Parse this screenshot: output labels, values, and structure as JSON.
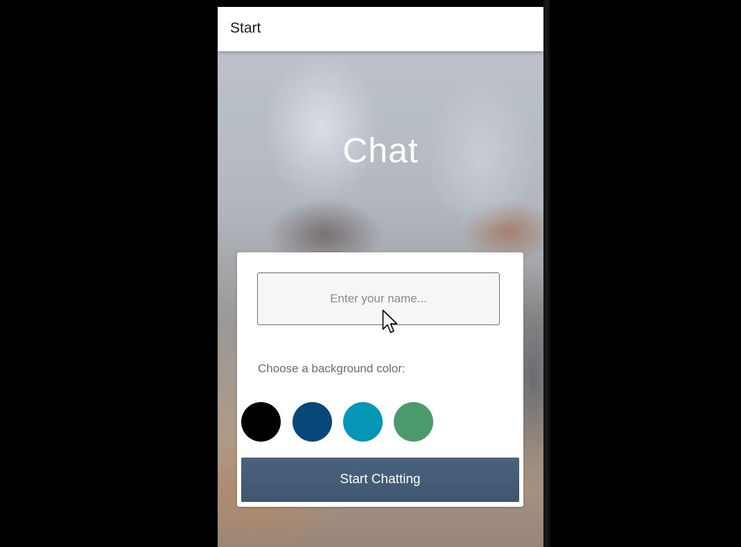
{
  "app_bar": {
    "title": "Start"
  },
  "main": {
    "title": "Chat"
  },
  "form": {
    "name_input": {
      "value": "",
      "placeholder": "Enter your name..."
    },
    "color_label": "Choose a background color:",
    "colors": [
      {
        "name": "black",
        "hex": "#000000"
      },
      {
        "name": "dark-blue",
        "hex": "#07477a"
      },
      {
        "name": "teal",
        "hex": "#0596b6"
      },
      {
        "name": "green",
        "hex": "#4a9a6c"
      }
    ],
    "start_button_label": "Start Chatting"
  },
  "theme": {
    "button_color": "#445a74",
    "app_bar_color": "#ffffff",
    "title_color": "#ffffff"
  }
}
